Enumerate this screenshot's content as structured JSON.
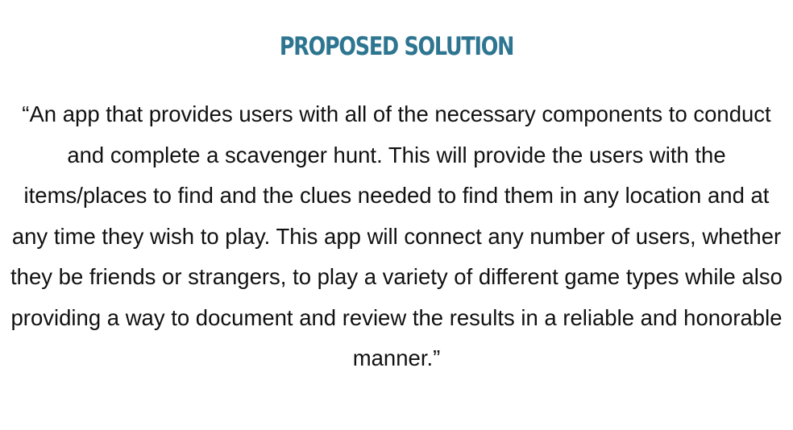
{
  "slide": {
    "title": "PROPOSED SOLUTION",
    "body": "“An app that provides users with all of the necessary components to conduct and complete a scavenger hunt. This will provide the users with the items/places to find and the clues needed to find them in any location and at any time they wish to play. This app will connect any number of users, whether they be friends or strangers, to play a variety of different game types while also providing a way to document and review the results in a reliable and honorable manner.”"
  },
  "colors": {
    "title": "#2d7590",
    "body_text": "#111111",
    "background": "#ffffff"
  }
}
